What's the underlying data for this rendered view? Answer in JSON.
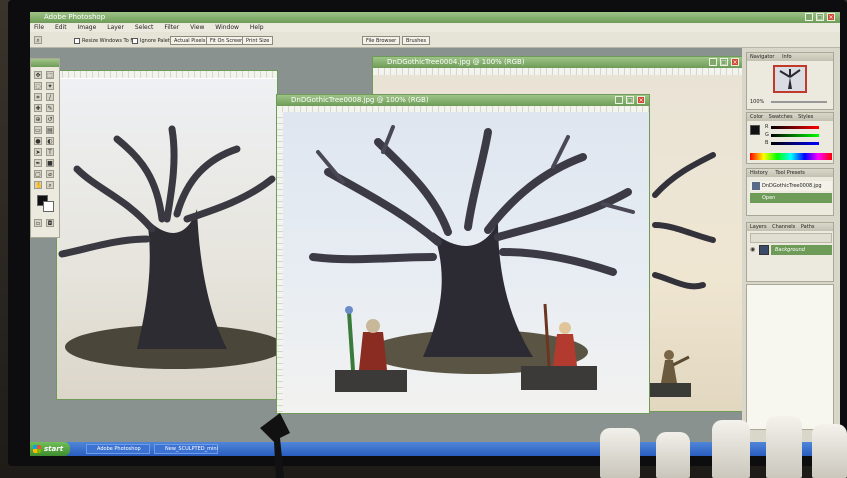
{
  "app": {
    "title": "Adobe Photoshop",
    "menus": [
      "File",
      "Edit",
      "Image",
      "Layer",
      "Select",
      "Filter",
      "View",
      "Window",
      "Help"
    ],
    "options_bar": {
      "resize_windows_label": "Resize Windows To Fit",
      "ignore_palettes_label": "Ignore Palettes",
      "buttons": [
        "Actual Pixels",
        "Fit On Screen",
        "Print Size"
      ],
      "well_tabs": [
        "File Browser",
        "Brushes"
      ]
    }
  },
  "documents": {
    "back": {
      "title": "DnDGothicTree0004.jpg @ 100% (RGB)"
    },
    "front": {
      "title": "DnDGothicTree0008.jpg @ 100% (RGB)"
    }
  },
  "panels": {
    "navigator": {
      "tabs": [
        "Navigator",
        "Info"
      ],
      "zoom": "100%"
    },
    "color": {
      "tabs": [
        "Color",
        "Swatches",
        "Styles"
      ],
      "channels": [
        "R",
        "G",
        "B"
      ]
    },
    "history": {
      "tabs": [
        "History",
        "Tool Presets"
      ],
      "items": [
        "DnDGothicTree0008.jpg",
        "Open"
      ]
    },
    "layers": {
      "tabs": [
        "Layers",
        "Channels",
        "Paths"
      ],
      "items": [
        "Background"
      ]
    }
  },
  "taskbar": {
    "start_label": "start",
    "items": [
      "Adobe Photoshop",
      "New_SCULPTED_mini"
    ]
  },
  "colors": {
    "title_green": "#6e9c58",
    "panel_bg": "#eceade",
    "taskbar_blue": "#2a5dbf",
    "canvas_gray": "#7f8786"
  },
  "icons": [
    "move-icon",
    "marquee-icon",
    "lasso-icon",
    "brush-icon",
    "eraser-icon",
    "zoom-icon",
    "hand-icon",
    "foreground-color-icon"
  ]
}
